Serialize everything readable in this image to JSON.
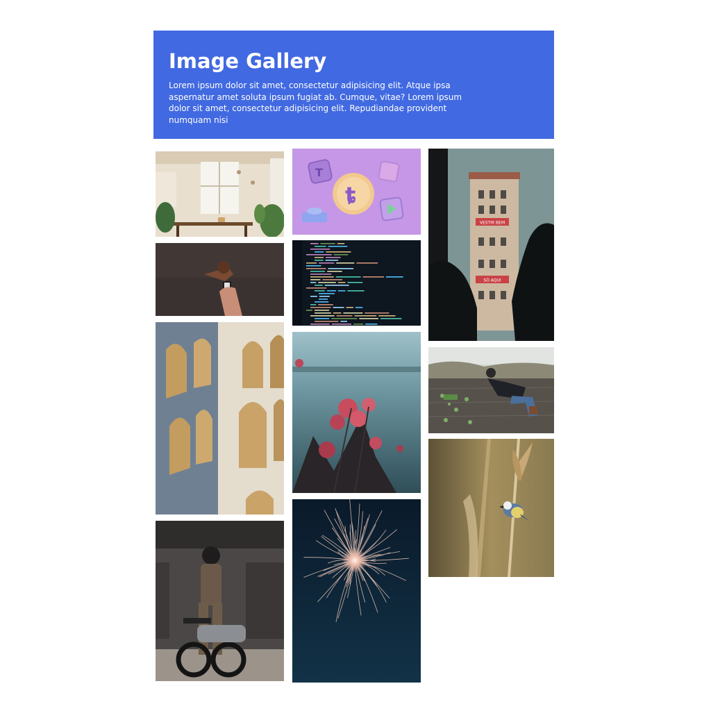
{
  "gallery": {
    "title": "Image Gallery",
    "description": "Lorem ipsum dolor sit amet, consectetur adipisicing elit. Atque ipsa aspernatur amet soluta ipsum fugiat ab. Cumque, vitae? Lorem ipsum dolor sit amet, consectetur adipisicing elit. Repudiandae provident numquam nisi",
    "colors": {
      "header_bg": "#4169e1",
      "header_text": "#ffffff",
      "page_bg": "#ffffff"
    },
    "images": [
      {
        "subject": "workspace-with-plants",
        "visible_text": ""
      },
      {
        "subject": "hand-holding-small-bottle",
        "visible_text": ""
      },
      {
        "subject": "arched-building-facade",
        "visible_text": ""
      },
      {
        "subject": "helmeted-rider-on-motorcycle",
        "visible_text": ""
      },
      {
        "subject": "crypto-coin-3d-icons",
        "visible_text": ""
      },
      {
        "subject": "code-on-screen",
        "visible_text": ""
      },
      {
        "subject": "pink-flowers-by-lake",
        "visible_text": ""
      },
      {
        "subject": "dandelion-seed-light-burst",
        "visible_text": ""
      },
      {
        "subject": "tall-old-building",
        "visible_text": "",
        "signs": [
          "VESTIR BEM",
          "SÓ AQUI"
        ]
      },
      {
        "subject": "person-gardening-seedlings",
        "visible_text": ""
      },
      {
        "subject": "bird-on-dry-grass",
        "visible_text": ""
      }
    ]
  }
}
